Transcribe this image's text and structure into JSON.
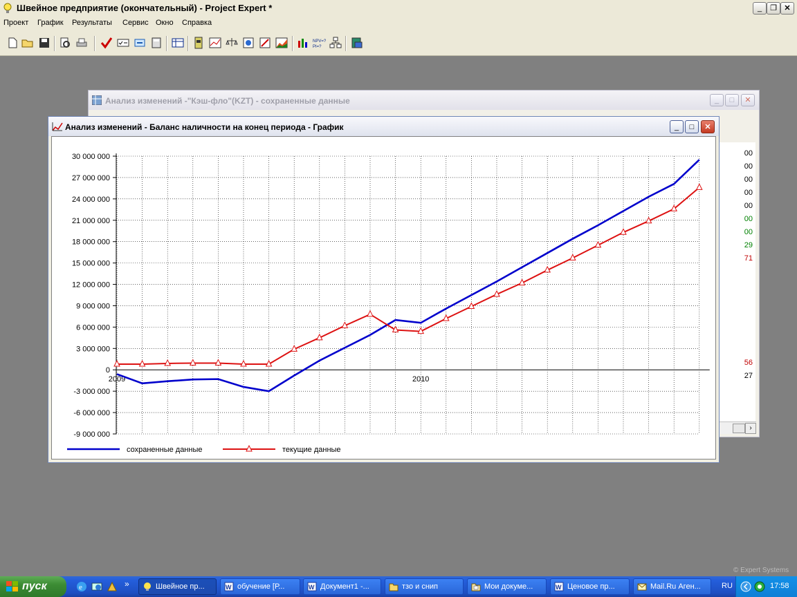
{
  "app": {
    "title": "Швейное предприятие (окончательный) - Project Expert *",
    "menu": [
      "Проект",
      "График",
      "Результаты",
      "Сервис",
      "Окно",
      "Справка"
    ]
  },
  "back_window": {
    "title": "Анализ изменений -\"Кэш-фло\"(KZT) - сохраненные данные",
    "visible_values": [
      {
        "text": "00",
        "color": "#000000"
      },
      {
        "text": "00",
        "color": "#000000"
      },
      {
        "text": "00",
        "color": "#000000"
      },
      {
        "text": "00",
        "color": "#000000"
      },
      {
        "text": "00",
        "color": "#000000"
      },
      {
        "text": "00",
        "color": "#008000"
      },
      {
        "text": "00",
        "color": "#008000"
      },
      {
        "text": "29",
        "color": "#008000"
      },
      {
        "text": "71",
        "color": "#c00000"
      },
      {
        "text": "56",
        "color": "#c00000"
      },
      {
        "text": "27",
        "color": "#000000"
      }
    ]
  },
  "front_window": {
    "title": "Анализ изменений - Баланс наличности на конец периода - График"
  },
  "chart_data": {
    "type": "line",
    "title": "",
    "ylim": [
      -9000000,
      30000000
    ],
    "y_ticks": [
      30000000,
      27000000,
      24000000,
      21000000,
      18000000,
      15000000,
      12000000,
      9000000,
      6000000,
      3000000,
      0,
      -3000000,
      -6000000,
      -9000000
    ],
    "y_tick_labels": [
      "30 000 000",
      "27 000 000",
      "24 000 000",
      "21 000 000",
      "18 000 000",
      "15 000 000",
      "12 000 000",
      "9 000 000",
      "6 000 000",
      "3 000 000",
      "0",
      "-3 000 000",
      "-6 000 000",
      "-9 000 000"
    ],
    "x_labels": [
      {
        "index": 0,
        "text": "2009"
      },
      {
        "index": 12,
        "text": "2010"
      }
    ],
    "grid": true,
    "legend_position": "bottom-left",
    "series": [
      {
        "name": "сохраненные данные",
        "color": "#0000cc",
        "marker": "none",
        "values": [
          -600000,
          -1900000,
          -1600000,
          -1350000,
          -1300000,
          -2400000,
          -3000000,
          -800000,
          1300000,
          3100000,
          4900000,
          7000000,
          6600000,
          8600000,
          10500000,
          12400000,
          14400000,
          16400000,
          18400000,
          20300000,
          22300000,
          24300000,
          26100000,
          29500000
        ]
      },
      {
        "name": "текущие данные",
        "color": "#dd1111",
        "marker": "triangle",
        "values": [
          800000,
          800000,
          900000,
          950000,
          950000,
          800000,
          800000,
          2900000,
          4500000,
          6200000,
          7800000,
          5600000,
          5400000,
          7200000,
          8900000,
          10600000,
          12200000,
          14000000,
          15700000,
          17500000,
          19300000,
          20900000,
          22600000,
          25600000
        ]
      }
    ]
  },
  "taskbar": {
    "start_label": "пуск",
    "tasks": [
      {
        "label": "Швейное пр...",
        "active": true
      },
      {
        "label": "обучение [Р...",
        "active": false
      },
      {
        "label": "Документ1 -...",
        "active": false
      },
      {
        "label": "тзо и снип",
        "active": false
      },
      {
        "label": "Мои докуме...",
        "active": false
      },
      {
        "label": "Ценовое пр...",
        "active": false
      },
      {
        "label": "Mail.Ru Аген...",
        "active": false
      }
    ],
    "lang": "RU",
    "clock": "17:58",
    "watermark": "© Expert Systems"
  }
}
